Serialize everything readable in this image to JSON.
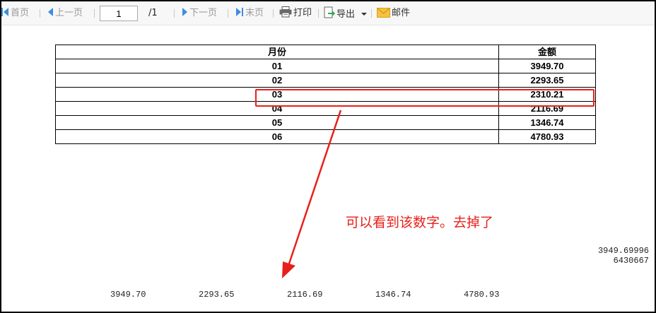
{
  "toolbar": {
    "first_label": "首页",
    "prev_label": "上一页",
    "page_value": "1",
    "page_total": "/1",
    "next_label": "下一页",
    "last_label": "末页",
    "print_label": "打印",
    "export_label": "导出",
    "mail_label": "邮件"
  },
  "table": {
    "headers": [
      "月份",
      "金额"
    ],
    "rows": [
      {
        "month": "01",
        "amount": "3949.70"
      },
      {
        "month": "02",
        "amount": "2293.65"
      },
      {
        "month": "03",
        "amount": "2310.21"
      },
      {
        "month": "04",
        "amount": "2116.69"
      },
      {
        "month": "05",
        "amount": "1346.74"
      },
      {
        "month": "06",
        "amount": "4780.93"
      }
    ]
  },
  "annotation": "可以看到该数字。去掉了",
  "colors": {
    "annotation_red": "#e8201a",
    "toolbar_blue": "#3d8de0"
  },
  "leak_value": {
    "line1": "3949.69996",
    "line2": "6430667"
  },
  "bottom_values": [
    "3949.70",
    "2293.65",
    "2116.69",
    "1346.74",
    "4780.93"
  ]
}
